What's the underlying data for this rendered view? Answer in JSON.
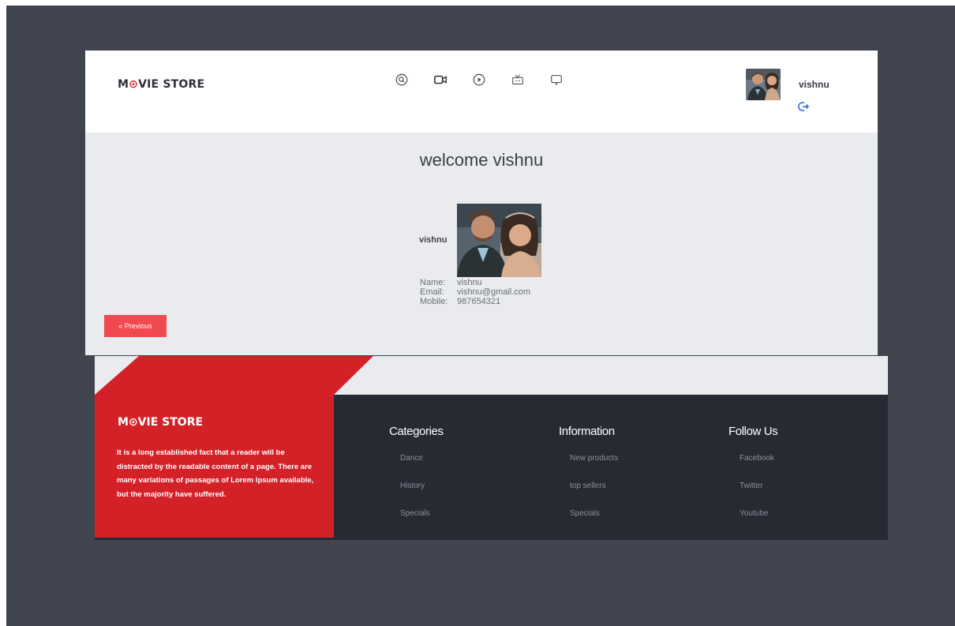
{
  "header": {
    "logo_prefix": "M",
    "logo_o": "O",
    "logo_suffix": "VIE STORE",
    "nav_icons": [
      "search-icon",
      "video-camera-icon",
      "play-icon",
      "tv-icon",
      "cast-icon"
    ],
    "username": "vishnu"
  },
  "main": {
    "welcome": "welcome vishnu",
    "profile_label": "vishnu",
    "details": [
      {
        "key": "Name:",
        "value": "vishnu"
      },
      {
        "key": "Email:",
        "value": "vishnu@gmail.com"
      },
      {
        "key": "Mobile:",
        "value": "987654321"
      }
    ],
    "previous_label": "« Previous"
  },
  "footer": {
    "logo_prefix": "M",
    "logo_o": "O",
    "logo_suffix": "VIE STORE",
    "about": "It is a long established fact that a reader will be distracted by the readable content of a page. There are many variations of passages of Lorem Ipsum available, but the majority have suffered.",
    "columns": [
      {
        "title": "Categories",
        "items": [
          "Dance",
          "History",
          "Specials"
        ]
      },
      {
        "title": "Information",
        "items": [
          "New products",
          "top sellers",
          "Specials"
        ]
      },
      {
        "title": "Follow Us",
        "items": [
          "Facebook",
          "Twitter",
          "Youtube"
        ]
      }
    ]
  },
  "colors": {
    "brand_red": "#d42128",
    "button_red": "#f0494f",
    "footer_dark": "#262a33",
    "backdrop": "#40444f",
    "accent_blue": "#2f6fd6"
  }
}
